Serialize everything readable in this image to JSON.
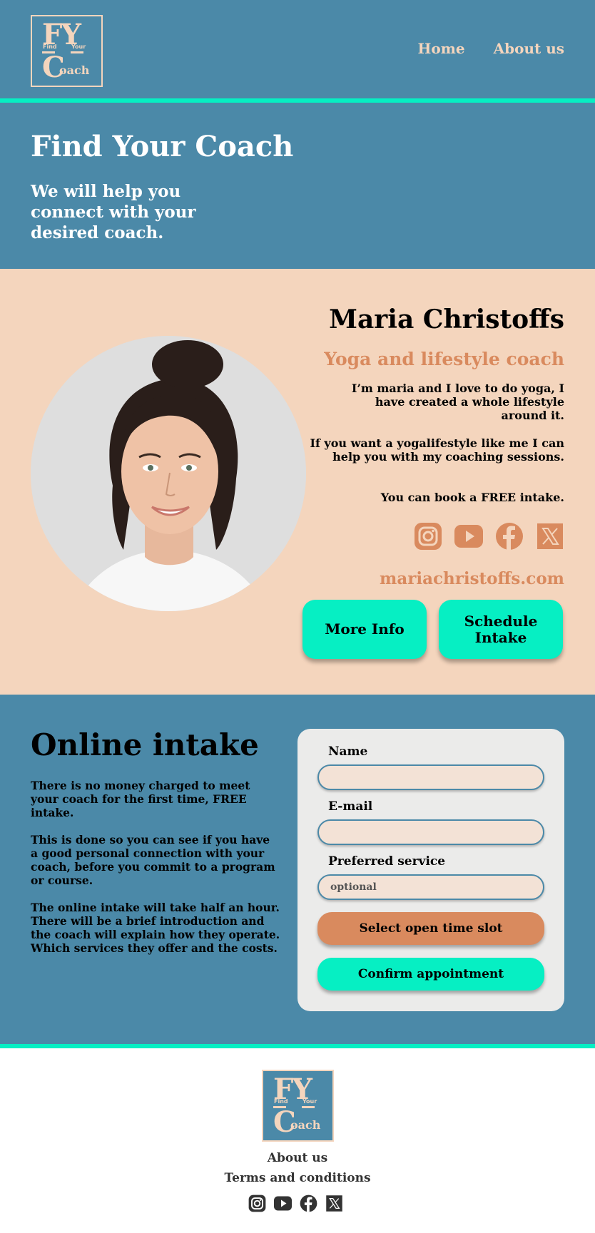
{
  "colors": {
    "primary": "#4b89a8",
    "accent": "#06efc3",
    "peach": "#f4d5bd",
    "orange": "#d98a5e"
  },
  "header": {
    "logo": {
      "line1": "FY",
      "find": "Find",
      "your": "Your",
      "coach_c": "C",
      "coach_rest": "oach"
    },
    "nav": [
      "Home",
      "About us"
    ]
  },
  "hero": {
    "title": "Find Your Coach",
    "subtitle": "We will help you connect with your desired coach."
  },
  "coach": {
    "name": "Maria Christoffs",
    "role": "Yoga and lifestyle coach",
    "paragraphs": [
      "I’m maria and I love to do yoga, I have created a whole lifestyle around it.",
      "If you want a yogalifestyle like me I can help you with my coaching sessions.",
      "You can book a FREE intake."
    ],
    "social_icons": [
      "instagram-icon",
      "youtube-icon",
      "facebook-icon",
      "x-icon"
    ],
    "website": "mariachristoffs.com",
    "buttons": {
      "more_info": "More Info",
      "schedule": "Schedule Intake"
    }
  },
  "intake": {
    "title": "Online intake",
    "paragraphs": [
      "There is no money charged to meet your coach for the first time, FREE intake.",
      "This is done so you can see if you have a good personal connection with your coach, before you commit to a program or course.",
      "The online intake will take half an hour. There will be a brief introduction and the coach will explain how they operate. Which services they offer and the costs."
    ],
    "form": {
      "name_label": "Name",
      "name_value": "",
      "email_label": "E-mail",
      "email_value": "",
      "service_label": "Preferred service",
      "service_placeholder": "optional",
      "select_button": "Select open time slot",
      "confirm_button": "Confirm appointment"
    }
  },
  "footer": {
    "links": [
      "About us",
      "Terms and conditions"
    ],
    "social_icons": [
      "instagram-icon",
      "youtube-icon",
      "facebook-icon",
      "x-icon"
    ]
  }
}
